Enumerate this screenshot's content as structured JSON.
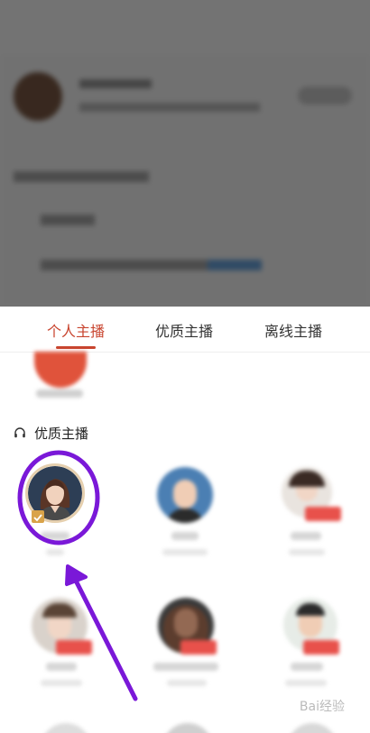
{
  "tabs": [
    {
      "label": "个人主播",
      "active": true
    },
    {
      "label": "优质主播",
      "active": false
    },
    {
      "label": "离线主播",
      "active": false
    }
  ],
  "section": {
    "title": "优质主播",
    "icon": "headphones-icon"
  },
  "watermark": "Bai经验",
  "colors": {
    "accent": "#c8442e",
    "highlight_circle": "#7a18d8",
    "arrow": "#7a18d8"
  }
}
